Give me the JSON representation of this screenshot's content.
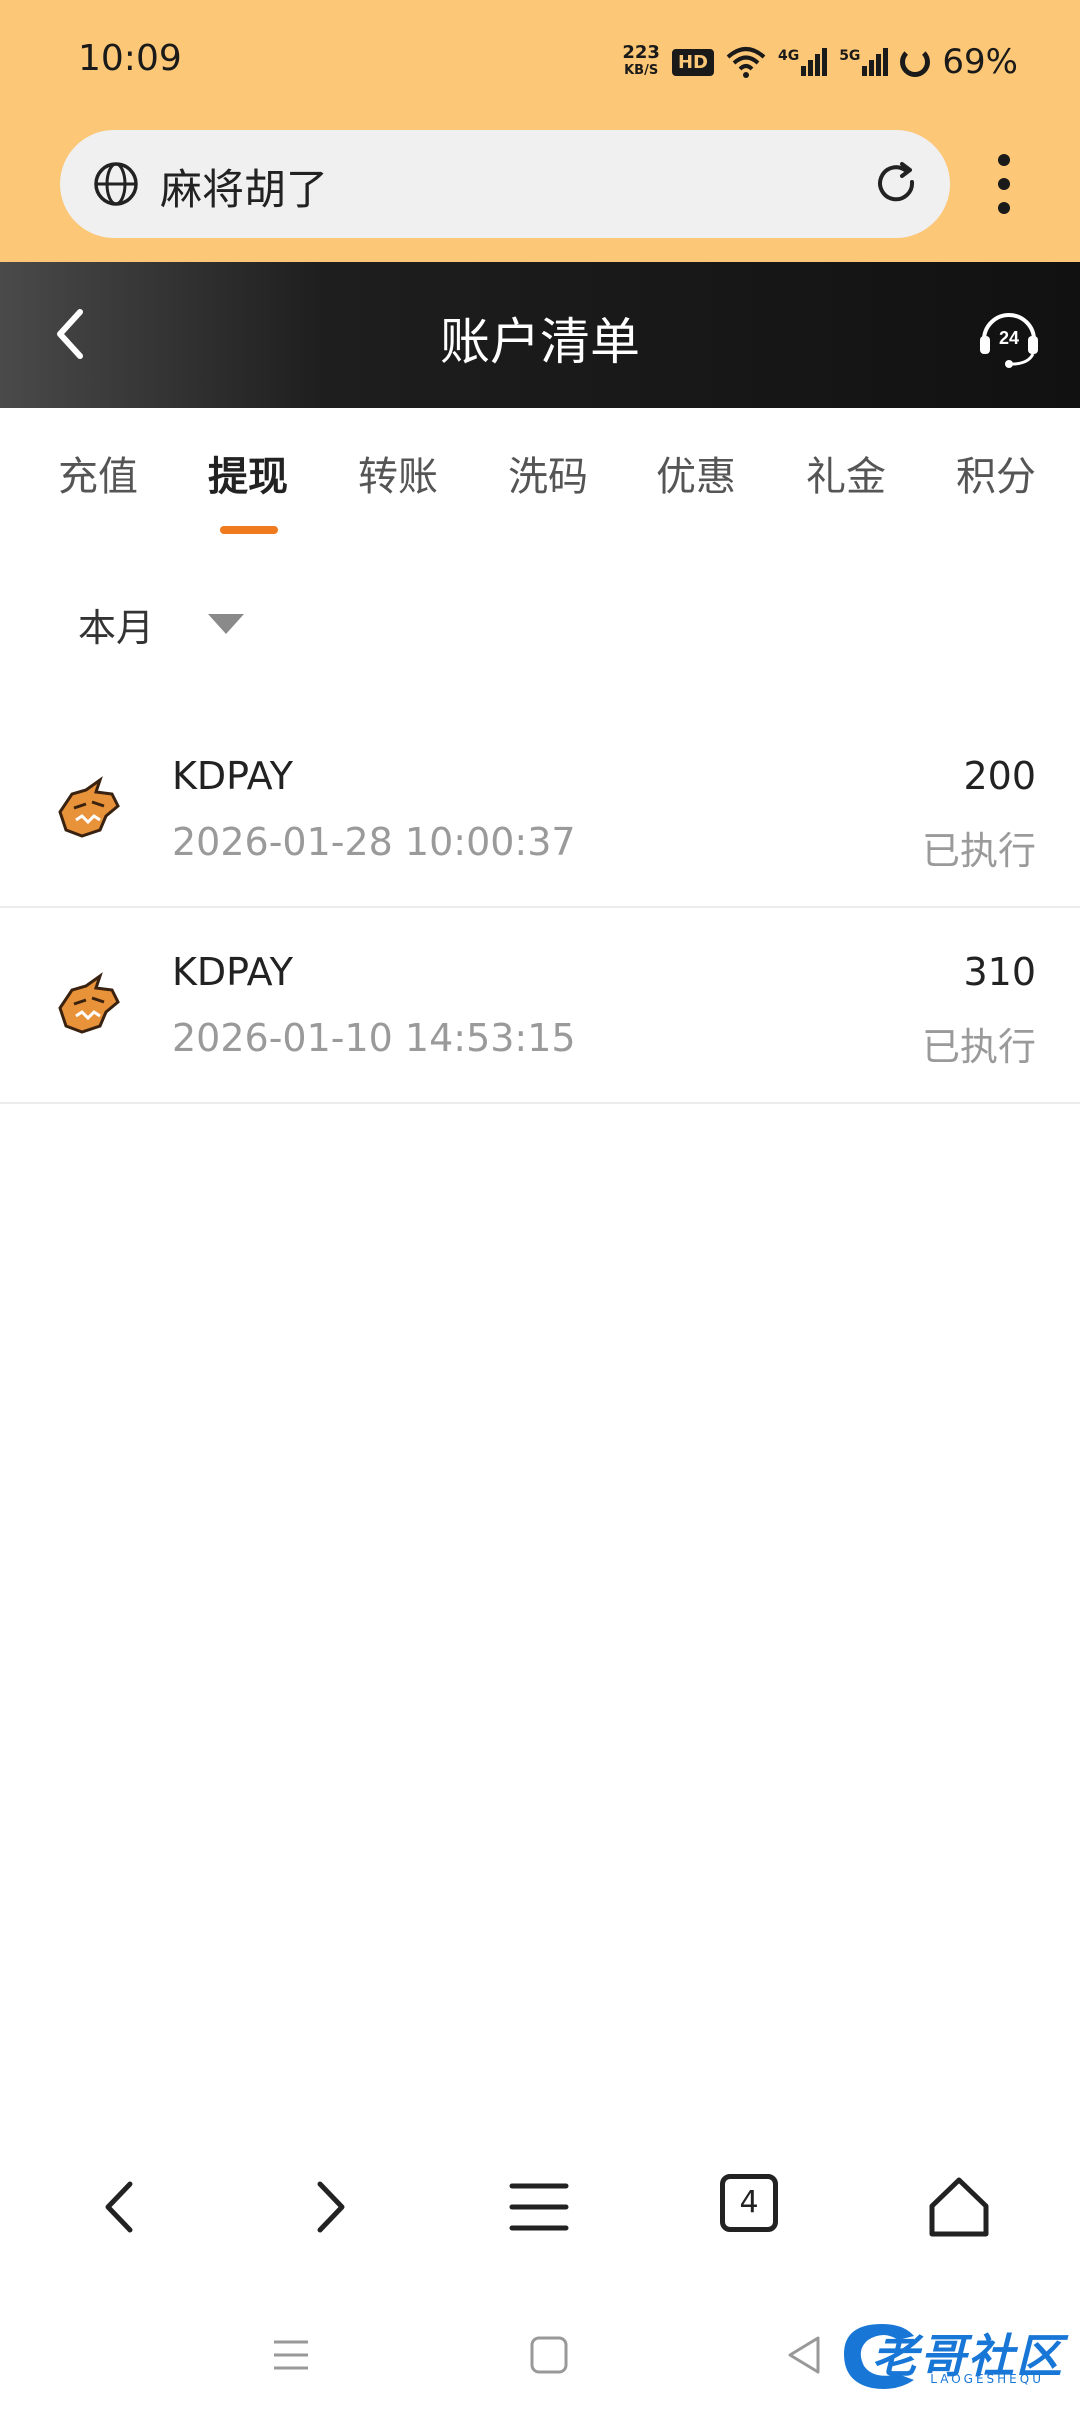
{
  "status_bar": {
    "time": "10:09",
    "net_speed_value": "223",
    "net_speed_unit": "KB/S",
    "hd_badge": "HD",
    "signal_4g": "4G",
    "signal_5g": "5G",
    "battery": "69%"
  },
  "browser": {
    "url_text": "麻将胡了"
  },
  "header": {
    "title": "账户清单",
    "support_badge": "24"
  },
  "tabs": [
    {
      "label": "充值",
      "active": false
    },
    {
      "label": "提现",
      "active": true
    },
    {
      "label": "转账",
      "active": false
    },
    {
      "label": "洗码",
      "active": false
    },
    {
      "label": "优惠",
      "active": false
    },
    {
      "label": "礼金",
      "active": false
    },
    {
      "label": "积分",
      "active": false
    }
  ],
  "filter": {
    "selected": "本月"
  },
  "records": [
    {
      "name": "KDPAY",
      "datetime": "2026-01-28 10:00:37",
      "amount": "200",
      "status": "已执行"
    },
    {
      "name": "KDPAY",
      "datetime": "2026-01-10 14:53:15",
      "amount": "310",
      "status": "已执行"
    }
  ],
  "browser_nav": {
    "tab_count": "4"
  },
  "watermark": {
    "text": "老哥社区",
    "subtext": "LAOGESHEQU"
  },
  "colors": {
    "status_bg": "#fcc776",
    "accent": "#f07a1e",
    "header_bg": "#111111",
    "watermark": "#1877d6"
  }
}
